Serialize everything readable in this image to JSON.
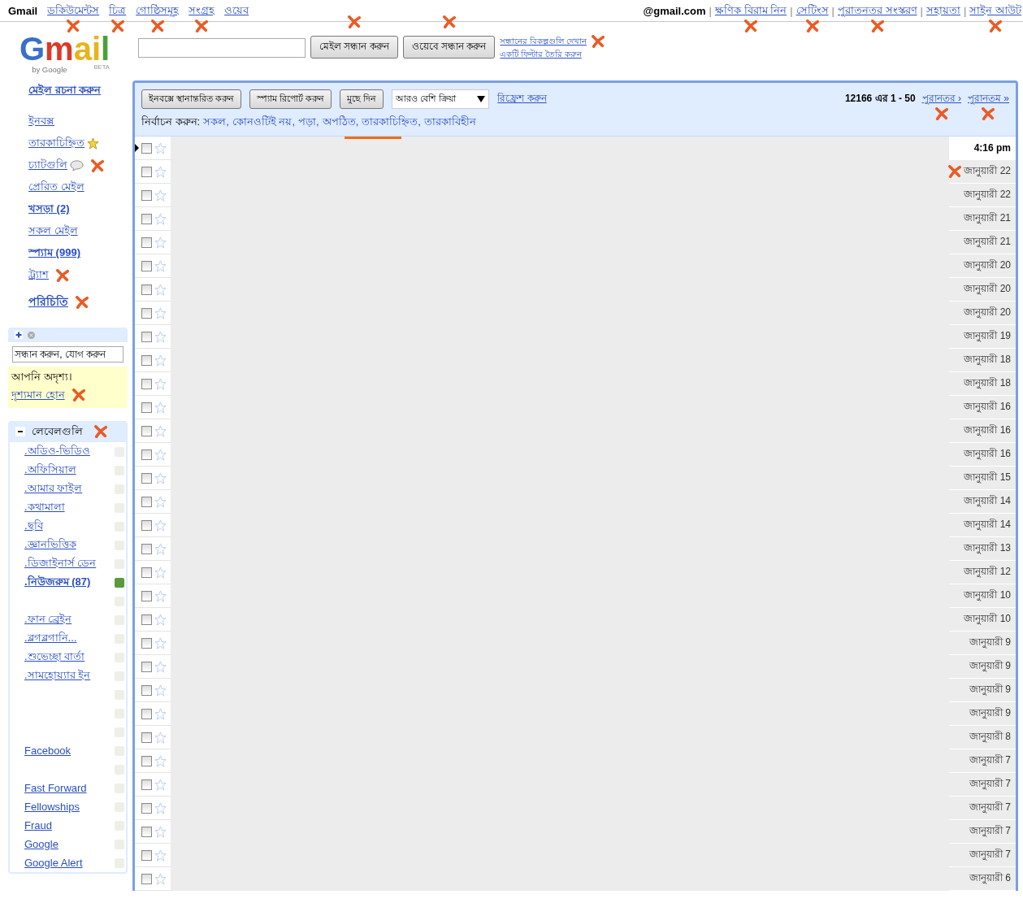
{
  "top_nav": {
    "brand": "Gmail",
    "links": [
      {
        "label": "ডকিউমেন্টস",
        "marked": true
      },
      {
        "label": "চিত্র",
        "marked": true
      },
      {
        "label": "গোষ্ঠিসমূহ",
        "marked": true
      },
      {
        "label": "সংগ্রহ",
        "marked": true
      },
      {
        "label": "ওয়েব",
        "marked": false
      }
    ]
  },
  "account": {
    "email": "@gmail.com",
    "separator": "|",
    "links": [
      {
        "label": "ক্ষণিক বিরাম নিন",
        "marked": true
      },
      {
        "label": "সেটিংস",
        "marked": true
      },
      {
        "label": "পুরাতনতর সংস্করণ",
        "marked": true
      },
      {
        "label": "সহায়তা",
        "marked": false
      },
      {
        "label": "সাইন আউট",
        "marked": true
      }
    ]
  },
  "logo": {
    "word": "Gmail",
    "byline": "by Google",
    "badge": "BETA"
  },
  "search": {
    "buttons": [
      {
        "label": "মেইল সন্ধান করুন",
        "marked": true
      },
      {
        "label": "ওয়েবে সন্ধান করুন",
        "marked": true
      }
    ],
    "links": [
      {
        "label": "সন্ধানের বিকল্পগুলি দেখান",
        "marked": true
      },
      {
        "label": "একটি ফিল্টার তৈরি করুন",
        "marked": false
      }
    ]
  },
  "sidebar": {
    "compose": "মেইল রচনা করুন",
    "folders": [
      {
        "label": "ইনবক্স",
        "bold": false,
        "marked": false
      },
      {
        "label": "তারকাচিহ্নিত",
        "bold": false,
        "marked": false
      },
      {
        "label": "চ্যাটগুলি",
        "bold": false,
        "marked": true
      },
      {
        "label": "প্রেরিত মেইল",
        "bold": false,
        "marked": false
      },
      {
        "label": "খসড়া (2)",
        "bold": true,
        "marked": false
      },
      {
        "label": "সকল মেইল",
        "bold": false,
        "marked": false
      },
      {
        "label": "স্প্যাম (999)",
        "bold": true,
        "marked": false
      },
      {
        "label": "ট্র্যাশ",
        "bold": false,
        "marked": true
      }
    ],
    "contacts": {
      "label": "পরিচিতি",
      "marked": true
    }
  },
  "chat": {
    "search_placeholder": "সন্ধান করুন, যোগ করুন",
    "status": "আপনি অদৃশ্য।",
    "link": {
      "label": "দৃশ্যমান হোন",
      "marked": true
    }
  },
  "labels": {
    "title": "লেবেলগুলি",
    "expanded": true,
    "marked": true,
    "items": [
      {
        "label": ".অডিও-ভিডিও",
        "bold": false,
        "color": "#eeeeee"
      },
      {
        "label": ".অফিসিয়াল",
        "bold": false,
        "color": "#eef0e8"
      },
      {
        "label": ".আমার ফাইল",
        "bold": false,
        "color": "#eef0e8"
      },
      {
        "label": ".কথামালা",
        "bold": false,
        "color": "#eef0e8"
      },
      {
        "label": ".ছবি",
        "bold": false,
        "color": "#eef0e8"
      },
      {
        "label": ".জ্ঞানভিত্তিক",
        "bold": false,
        "color": "#eef0e8"
      },
      {
        "label": ".ডিজাইনার্স ডেন",
        "bold": false,
        "color": "#eef0e8"
      },
      {
        "label": ".নিউজরুম (87)",
        "bold": true,
        "color": "#5a9a3a"
      },
      {
        "color": "#eef0e8"
      },
      {
        "label": ".ফান ব্রেইন",
        "bold": false,
        "color": "#eef0e8"
      },
      {
        "label": ".ব্লগব্লগানি...",
        "bold": false,
        "color": "#eef0e8"
      },
      {
        "label": ".শুভেচ্ছা বার্তা",
        "bold": false,
        "color": "#eef0e8"
      },
      {
        "label": ".সামহোয়্যার ইন",
        "bold": false,
        "color": "#eef0e8"
      },
      {
        "color": "#eef0e8"
      },
      {
        "color": "#eef0e8"
      },
      {
        "color": "#eef0e8"
      },
      {
        "label": "Facebook",
        "bold": false,
        "color": "#eef0e8"
      },
      {
        "color": "#eef0e8"
      },
      {
        "label": "Fast Forward",
        "bold": false,
        "color": "#eef0e8"
      },
      {
        "label": "Fellowships",
        "bold": false,
        "color": "#eef0e8"
      },
      {
        "label": "Fraud",
        "bold": false,
        "color": "#eef0e8"
      },
      {
        "label": "Google",
        "bold": false,
        "color": "#eef0e8"
      },
      {
        "label": "Google Alert",
        "bold": false,
        "color": "#eef0e8"
      }
    ]
  },
  "toolbar": {
    "buttons": [
      "ইনবক্সে স্থানান্তরিত করুন",
      "স্প্যাম রিপোর্ট করুন",
      "মুছে দিন"
    ],
    "more_actions": "আরও বেশি ক্রিয়া",
    "refresh": "রিফ্রেশ করুন",
    "select_prefix": "নির্বাচন করুন:",
    "select_options": [
      "সকল,",
      "কোনওটিই নয়,",
      "পড়া,",
      "অপঠিত,",
      "তারকাচিহ্নিত,",
      "তারকাবিহীন"
    ],
    "range": "12166 এর 1 - 50",
    "pager": [
      {
        "label": "পুরানতর ›",
        "marked": true
      },
      {
        "label": "পুরানতম »",
        "marked": true
      }
    ]
  },
  "messages": [
    {
      "date": "4:16 pm",
      "unread": true,
      "current": true,
      "checked": false,
      "starred": false,
      "marked": false
    },
    {
      "date": "জানুয়ারী 22",
      "unread": false,
      "current": false,
      "checked": false,
      "starred": false,
      "marked": true
    },
    {
      "date": "জানুয়ারী 22",
      "unread": false,
      "current": false,
      "checked": false,
      "starred": false,
      "marked": false
    },
    {
      "date": "জানুয়ারী 21",
      "unread": false,
      "current": false,
      "checked": false,
      "starred": false,
      "marked": false
    },
    {
      "date": "জানুয়ারী 21",
      "unread": false,
      "current": false,
      "checked": false,
      "starred": false,
      "marked": false
    },
    {
      "date": "জানুয়ারী 20",
      "unread": false,
      "current": false,
      "checked": false,
      "starred": false,
      "marked": false
    },
    {
      "date": "জানুয়ারী 20",
      "unread": false,
      "current": false,
      "checked": false,
      "starred": false,
      "marked": false
    },
    {
      "date": "জানুয়ারী 20",
      "unread": false,
      "current": false,
      "checked": false,
      "starred": false,
      "marked": false
    },
    {
      "date": "জানুয়ারী 19",
      "unread": false,
      "current": false,
      "checked": false,
      "starred": false,
      "marked": false
    },
    {
      "date": "জানুয়ারী 18",
      "unread": false,
      "current": false,
      "checked": false,
      "starred": false,
      "marked": false
    },
    {
      "date": "জানুয়ারী 18",
      "unread": false,
      "current": false,
      "checked": false,
      "starred": false,
      "marked": false
    },
    {
      "date": "জানুয়ারী 16",
      "unread": false,
      "current": false,
      "checked": false,
      "starred": false,
      "marked": false
    },
    {
      "date": "জানুয়ারী 16",
      "unread": false,
      "current": false,
      "checked": false,
      "starred": false,
      "marked": false
    },
    {
      "date": "জানুয়ারী 16",
      "unread": false,
      "current": false,
      "checked": false,
      "starred": false,
      "marked": false
    },
    {
      "date": "জানুয়ারী 15",
      "unread": false,
      "current": false,
      "checked": false,
      "starred": false,
      "marked": false
    },
    {
      "date": "জানুয়ারী 14",
      "unread": false,
      "current": false,
      "checked": false,
      "starred": false,
      "marked": false
    },
    {
      "date": "জানুয়ারী 14",
      "unread": false,
      "current": false,
      "checked": false,
      "starred": false,
      "marked": false
    },
    {
      "date": "জানুয়ারী 13",
      "unread": false,
      "current": false,
      "checked": false,
      "starred": false,
      "marked": false
    },
    {
      "date": "জানুয়ারী 12",
      "unread": false,
      "current": false,
      "checked": false,
      "starred": false,
      "marked": false
    },
    {
      "date": "জানুয়ারী 10",
      "unread": false,
      "current": false,
      "checked": false,
      "starred": false,
      "marked": false
    },
    {
      "date": "জানুয়ারী 10",
      "unread": false,
      "current": false,
      "checked": false,
      "starred": false,
      "marked": false
    },
    {
      "date": "জানুয়ারী 9",
      "unread": false,
      "current": false,
      "checked": false,
      "starred": false,
      "marked": false
    },
    {
      "date": "জানুয়ারী 9",
      "unread": false,
      "current": false,
      "checked": false,
      "starred": false,
      "marked": false
    },
    {
      "date": "জানুয়ারী 9",
      "unread": false,
      "current": false,
      "checked": false,
      "starred": false,
      "marked": false
    },
    {
      "date": "জানুয়ারী 9",
      "unread": false,
      "current": false,
      "checked": false,
      "starred": false,
      "marked": false
    },
    {
      "date": "জানুয়ারী 8",
      "unread": false,
      "current": false,
      "checked": false,
      "starred": false,
      "marked": false
    },
    {
      "date": "জানুয়ারী 7",
      "unread": false,
      "current": false,
      "checked": false,
      "starred": false,
      "marked": false
    },
    {
      "date": "জানুয়ারী 7",
      "unread": false,
      "current": false,
      "checked": false,
      "starred": false,
      "marked": false
    },
    {
      "date": "জানুয়ারী 7",
      "unread": false,
      "current": false,
      "checked": false,
      "starred": false,
      "marked": false
    },
    {
      "date": "জানুয়ারী 7",
      "unread": false,
      "current": false,
      "checked": false,
      "starred": false,
      "marked": false
    },
    {
      "date": "জানুয়ারী 7",
      "unread": false,
      "current": false,
      "checked": false,
      "starred": false,
      "marked": false
    },
    {
      "date": "জানুয়ারী 6",
      "unread": false,
      "current": false,
      "checked": false,
      "starred": false,
      "marked": false
    }
  ]
}
